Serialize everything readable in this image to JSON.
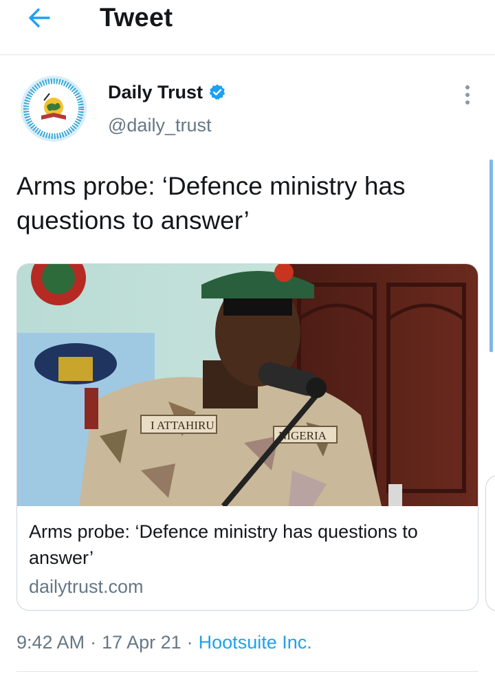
{
  "header": {
    "title": "Tweet",
    "back_icon": "arrow-left-icon",
    "accent": "#1da1f2"
  },
  "tweet": {
    "author_name": "Daily Trust",
    "author_handle": "@daily_trust",
    "verified": true,
    "text": "Arms probe: ‘Defence ministry has questions to answer’",
    "card": {
      "title": "Arms probe: ‘Defence ministry has questions to answer’",
      "domain": "dailytrust.com",
      "image_badges": {
        "name_tag": "I ATTAHIRU",
        "country_tag": "NIGERIA"
      }
    },
    "time": "9:42 AM",
    "sep1": "·",
    "date": "17 Apr 21",
    "sep2": "·",
    "source": "Hootsuite Inc."
  }
}
